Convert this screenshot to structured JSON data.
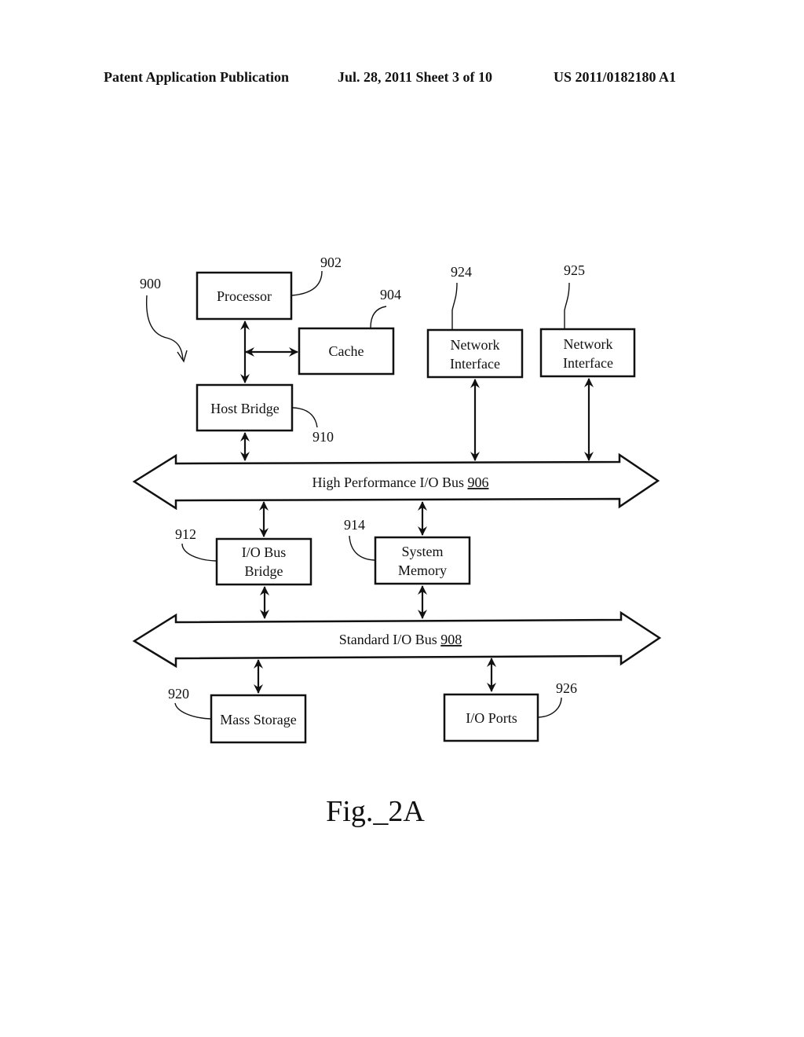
{
  "header": {
    "left": "Patent Application Publication",
    "date_sheet": "Jul. 28, 2011   Sheet 3 of 10",
    "number": "US 2011/0182180 A1"
  },
  "diagram": {
    "system_ref": "900",
    "blocks": {
      "processor": {
        "lines": [
          "Processor"
        ],
        "ref": "902"
      },
      "cache": {
        "lines": [
          "Cache"
        ],
        "ref": "904"
      },
      "host_bridge": {
        "lines": [
          "Host Bridge"
        ],
        "ref": "910"
      },
      "network_interface_1": {
        "lines": [
          "Network",
          "Interface"
        ],
        "ref": "924"
      },
      "network_interface_2": {
        "lines": [
          "Network",
          "Interface"
        ],
        "ref": "925"
      },
      "io_bus_bridge": {
        "lines": [
          "I/O Bus",
          "Bridge"
        ],
        "ref": "912"
      },
      "system_memory": {
        "lines": [
          "System",
          "Memory"
        ],
        "ref": "914"
      },
      "mass_storage": {
        "lines": [
          "Mass Storage"
        ],
        "ref": "920"
      },
      "io_ports": {
        "lines": [
          "I/O Ports"
        ],
        "ref": "926"
      }
    },
    "buses": {
      "high_performance": {
        "label": "High Performance I/O Bus ",
        "ref": "906"
      },
      "standard": {
        "label": "Standard I/O Bus ",
        "ref": "908"
      }
    },
    "caption": "Fig._2A"
  }
}
